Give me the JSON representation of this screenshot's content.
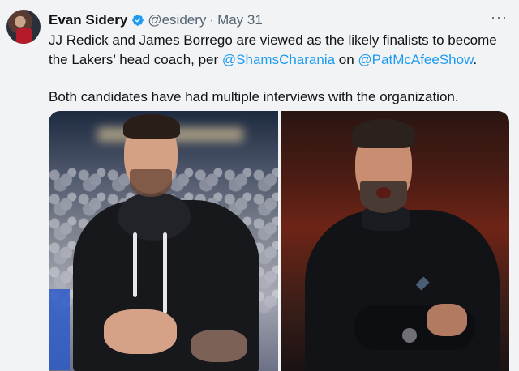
{
  "author": {
    "display_name": "Evan Sidery",
    "handle": "@esidery",
    "separator": "·",
    "date": "May 31",
    "verified_icon": "verified-badge-icon"
  },
  "tweet": {
    "line1_pre": "JJ Redick and James Borrego are viewed as the likely finalists to become the Lakers’ head coach, per ",
    "mention1": "@ShamsCharania",
    "line1_mid": " on ",
    "mention2": "@PatMcAfeeShow",
    "line1_post": ".",
    "paragraph2": "Both candidates have had multiple interviews with the organization."
  },
  "more_icon": "ellipsis-icon",
  "colors": {
    "link": "#1d9bf0",
    "verified": "#1d9bf0",
    "text": "#0f1419",
    "muted": "#536471",
    "background": "#f2f3f5"
  }
}
